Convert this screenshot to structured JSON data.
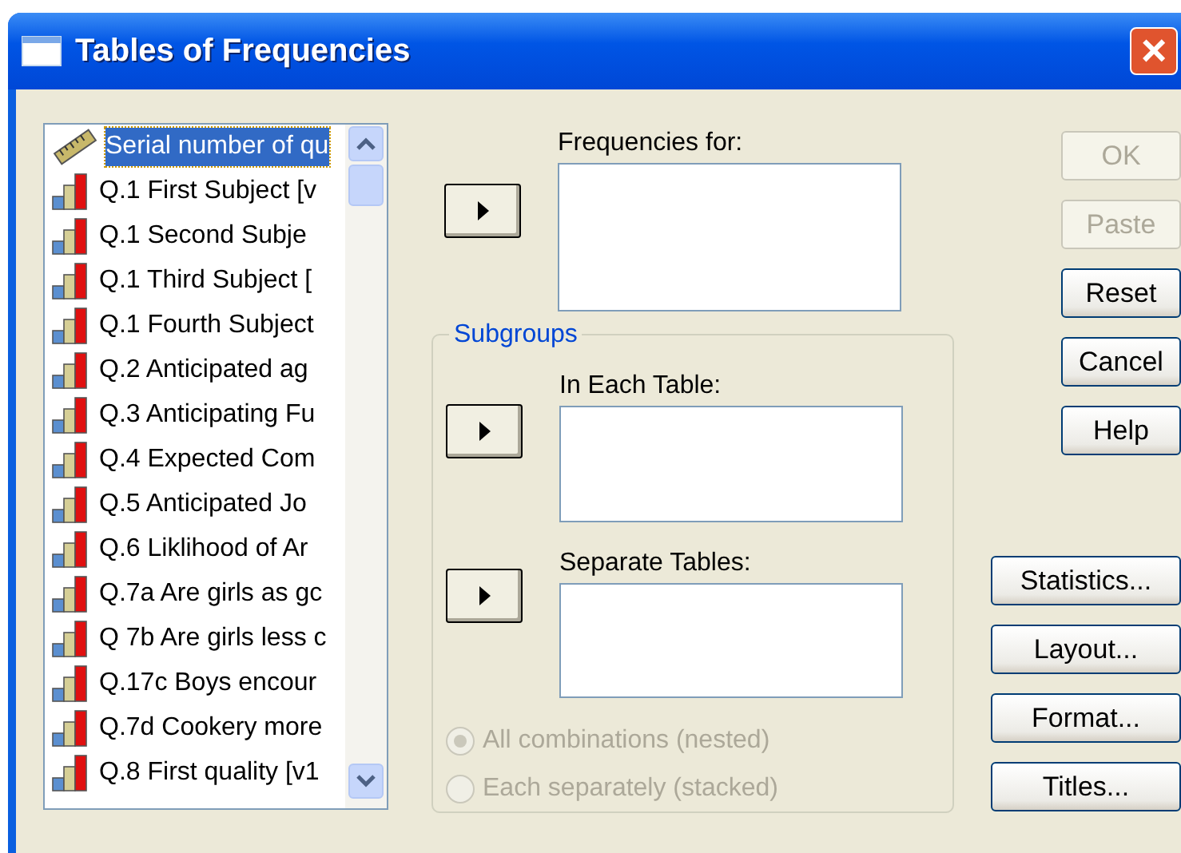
{
  "window": {
    "title": "Tables of Frequencies",
    "close": "×"
  },
  "variables": [
    {
      "label": "Serial number of qu",
      "kind": "scale",
      "selected": true
    },
    {
      "label": "Q.1  First Subject [v",
      "kind": "nominal",
      "selected": false
    },
    {
      "label": "Q.1  Second Subje",
      "kind": "nominal",
      "selected": false
    },
    {
      "label": "Q.1  Third Subject [",
      "kind": "nominal",
      "selected": false
    },
    {
      "label": "Q.1  Fourth Subject",
      "kind": "nominal",
      "selected": false
    },
    {
      "label": "Q.2  Anticipated ag",
      "kind": "nominal",
      "selected": false
    },
    {
      "label": "Q.3  Anticipating Fu",
      "kind": "nominal",
      "selected": false
    },
    {
      "label": "Q.4  Expected Com",
      "kind": "nominal",
      "selected": false
    },
    {
      "label": "Q.5  Anticipated Jo",
      "kind": "nominal",
      "selected": false
    },
    {
      "label": "Q.6  Liklihood of Ar",
      "kind": "nominal",
      "selected": false
    },
    {
      "label": "Q.7a Are girls as gc",
      "kind": "nominal",
      "selected": false
    },
    {
      "label": "Q 7b Are girls less c",
      "kind": "nominal",
      "selected": false
    },
    {
      "label": "Q.17c Boys encour",
      "kind": "nominal",
      "selected": false
    },
    {
      "label": "Q.7d Cookery more",
      "kind": "nominal",
      "selected": false
    },
    {
      "label": "Q.8  First quality [v1",
      "kind": "nominal",
      "selected": false
    }
  ],
  "frequencies_for": {
    "label": "Frequencies for:"
  },
  "subgroups": {
    "title": "Subgroups",
    "in_each_table": {
      "label": "In Each Table:"
    },
    "separate_tables": {
      "label": "Separate Tables:"
    },
    "options": [
      {
        "label": "All combinations (nested)",
        "checked": true,
        "disabled": true
      },
      {
        "label": "Each separately (stacked)",
        "checked": false,
        "disabled": true
      }
    ]
  },
  "buttons": [
    {
      "label": "OK",
      "disabled": true
    },
    {
      "label": "Paste",
      "disabled": true
    },
    {
      "label": "Reset",
      "disabled": false
    },
    {
      "label": "Cancel",
      "disabled": false
    },
    {
      "label": "Help",
      "disabled": false
    }
  ],
  "option_buttons": [
    {
      "label": "Statistics...",
      "disabled": false
    },
    {
      "label": "Layout...",
      "disabled": false
    },
    {
      "label": "Format...",
      "disabled": false
    },
    {
      "label": "Titles...",
      "disabled": false
    }
  ]
}
